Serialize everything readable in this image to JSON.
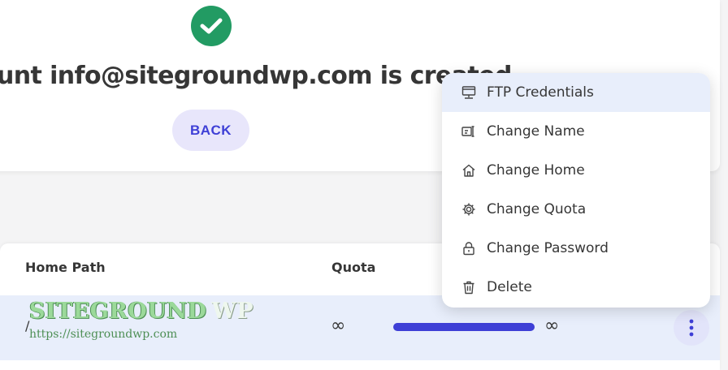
{
  "success": {
    "message": "ount info@sitegroundwp.com is created",
    "back_label": "BACK"
  },
  "table": {
    "headers": {
      "home_path": "Home Path",
      "quota": "Quota"
    },
    "row": {
      "home_path": "/",
      "quota": "∞",
      "usage": "∞",
      "usage_fill_fraction": 1.0
    }
  },
  "menu": {
    "items": [
      {
        "label": "FTP Credentials",
        "icon": "ftp-monitor-icon",
        "active": true
      },
      {
        "label": "Change Name",
        "icon": "rename-icon"
      },
      {
        "label": "Change Home",
        "icon": "home-icon"
      },
      {
        "label": "Change Quota",
        "icon": "gear-icon"
      },
      {
        "label": "Change Password",
        "icon": "lock-icon"
      },
      {
        "label": "Delete",
        "icon": "trash-icon"
      }
    ]
  },
  "watermark": {
    "name": "SITEGROUND",
    "suffix": "WP",
    "url": "https://sitegroundwp.com"
  },
  "colors": {
    "accent": "#3e3fd6",
    "success": "#229b63",
    "row_highlight": "#e8eefb"
  }
}
